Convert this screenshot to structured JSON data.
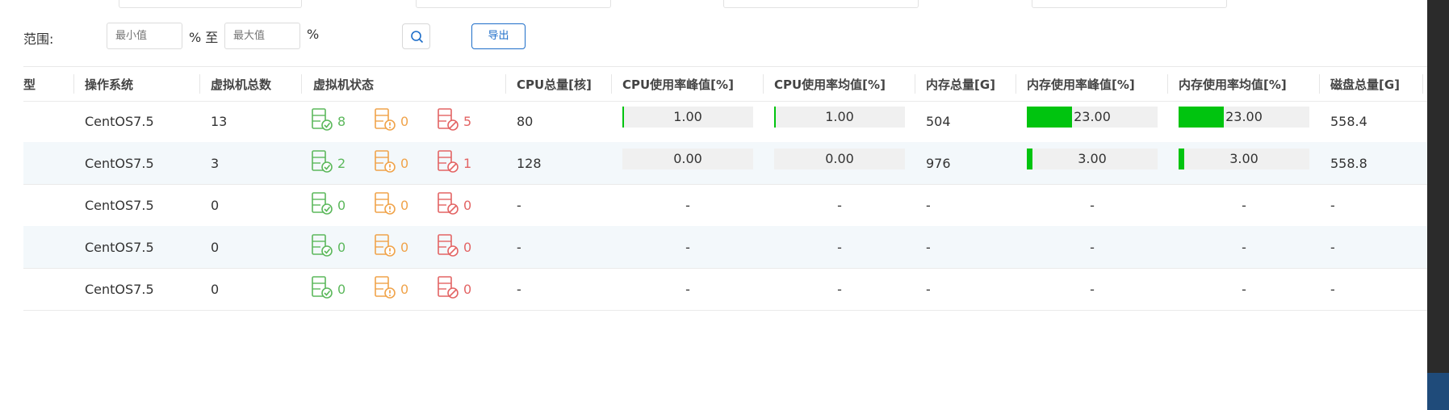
{
  "filter": {
    "range_label": "范围:",
    "min_placeholder": "最小值",
    "pct1": "% 至",
    "max_placeholder": "最大值",
    "pct2": "%",
    "export_label": "导出"
  },
  "table": {
    "headers": [
      "操作系统",
      "虚拟机总数",
      "虚拟机状态",
      "CPU总量[核]",
      "CPU使用率峰值[%]",
      "CPU使用率均值[%]",
      "内存总量[G]",
      "内存使用率峰值[%]",
      "内存使用率均值[%]",
      "磁盘总量[G]"
    ],
    "first_col_fragment": "型",
    "rows": [
      {
        "os": "CentOS7.5",
        "vm_total": "13",
        "vm_running": "8",
        "vm_warning": "0",
        "vm_stopped": "5",
        "cpu_total": "80",
        "cpu_peak": "1.00",
        "cpu_peak_level": 1.0,
        "cpu_avg": "1.00",
        "cpu_avg_level": 1.0,
        "mem_total": "504",
        "mem_peak": "23.00",
        "mem_peak_level": 23.0,
        "mem_avg": "23.00",
        "mem_avg_level": 23.0,
        "disk_total": "558.4"
      },
      {
        "os": "CentOS7.5",
        "vm_total": "3",
        "vm_running": "2",
        "vm_warning": "0",
        "vm_stopped": "1",
        "cpu_total": "128",
        "cpu_peak": "0.00",
        "cpu_peak_level": 0.0,
        "cpu_avg": "0.00",
        "cpu_avg_level": 0.0,
        "mem_total": "976",
        "mem_peak": "3.00",
        "mem_peak_level": 3.0,
        "mem_avg": "3.00",
        "mem_avg_level": 3.0,
        "disk_total": "558.8"
      },
      {
        "os": "CentOS7.5",
        "vm_total": "0",
        "vm_running": "0",
        "vm_warning": "0",
        "vm_stopped": "0",
        "cpu_total": "-",
        "cpu_peak": "-",
        "cpu_avg": "-",
        "mem_total": "-",
        "mem_peak": "-",
        "mem_avg": "-",
        "disk_total": "-"
      },
      {
        "os": "CentOS7.5",
        "vm_total": "0",
        "vm_running": "0",
        "vm_warning": "0",
        "vm_stopped": "0",
        "cpu_total": "-",
        "cpu_peak": "-",
        "cpu_avg": "-",
        "mem_total": "-",
        "mem_peak": "-",
        "mem_avg": "-",
        "disk_total": "-"
      },
      {
        "os": "CentOS7.5",
        "vm_total": "0",
        "vm_running": "0",
        "vm_warning": "0",
        "vm_stopped": "0",
        "cpu_total": "-",
        "cpu_peak": "-",
        "cpu_avg": "-",
        "mem_total": "-",
        "mem_peak": "-",
        "mem_avg": "-",
        "disk_total": "-"
      }
    ]
  },
  "icons": {
    "running": "server-check-icon",
    "warning": "server-warning-icon",
    "stopped": "server-blocked-icon",
    "search": "search-icon"
  },
  "colors": {
    "running": "#5cb85c",
    "warning": "#f0a34a",
    "stopped": "#e36464",
    "bar_fill": "#00c40f",
    "accent": "#1e6ec9"
  }
}
